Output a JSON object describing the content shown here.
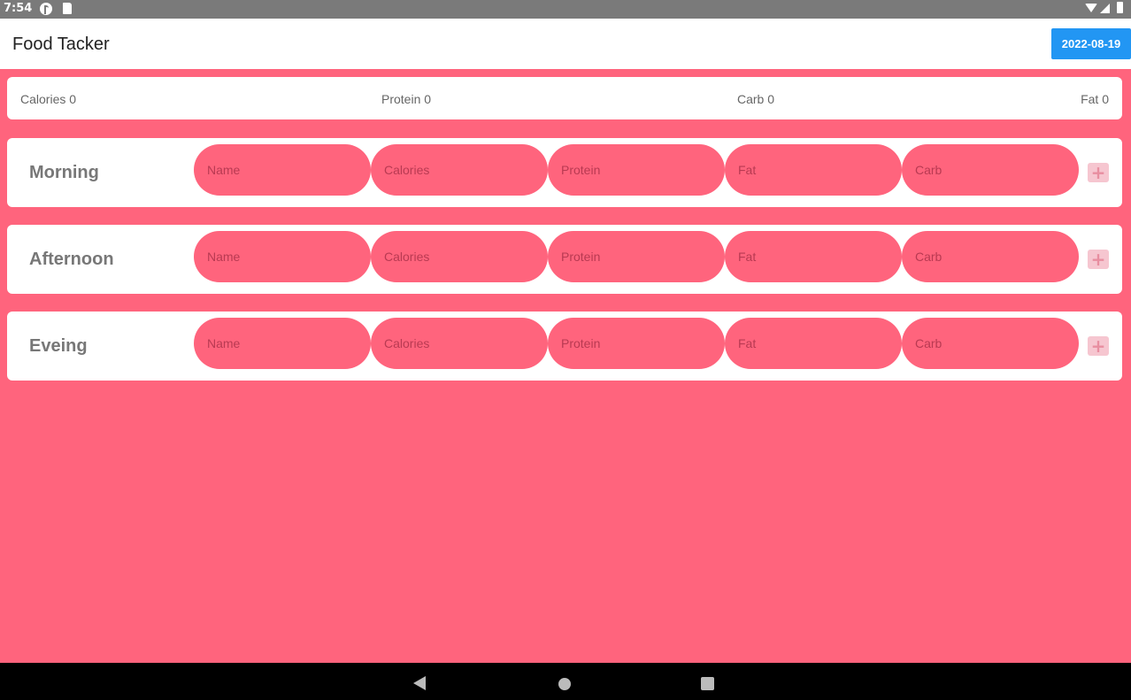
{
  "status_bar": {
    "time": "7:54"
  },
  "app_bar": {
    "title": "Food Tacker",
    "date": "2022-08-19"
  },
  "summary": {
    "calories": "Calories 0",
    "protein": "Protein 0",
    "carb": "Carb 0",
    "fat": "Fat 0"
  },
  "placeholders": {
    "name": "Name",
    "calories": "Calories",
    "protein": "Protein",
    "fat": "Fat",
    "carb": "Carb"
  },
  "meals": [
    {
      "label": "Morning"
    },
    {
      "label": "Afternoon"
    },
    {
      "label": "Eveing"
    }
  ],
  "add_label": "+",
  "colors": {
    "background": "#ff647d",
    "accent": "#2296f3",
    "pill": "#ff647d"
  }
}
